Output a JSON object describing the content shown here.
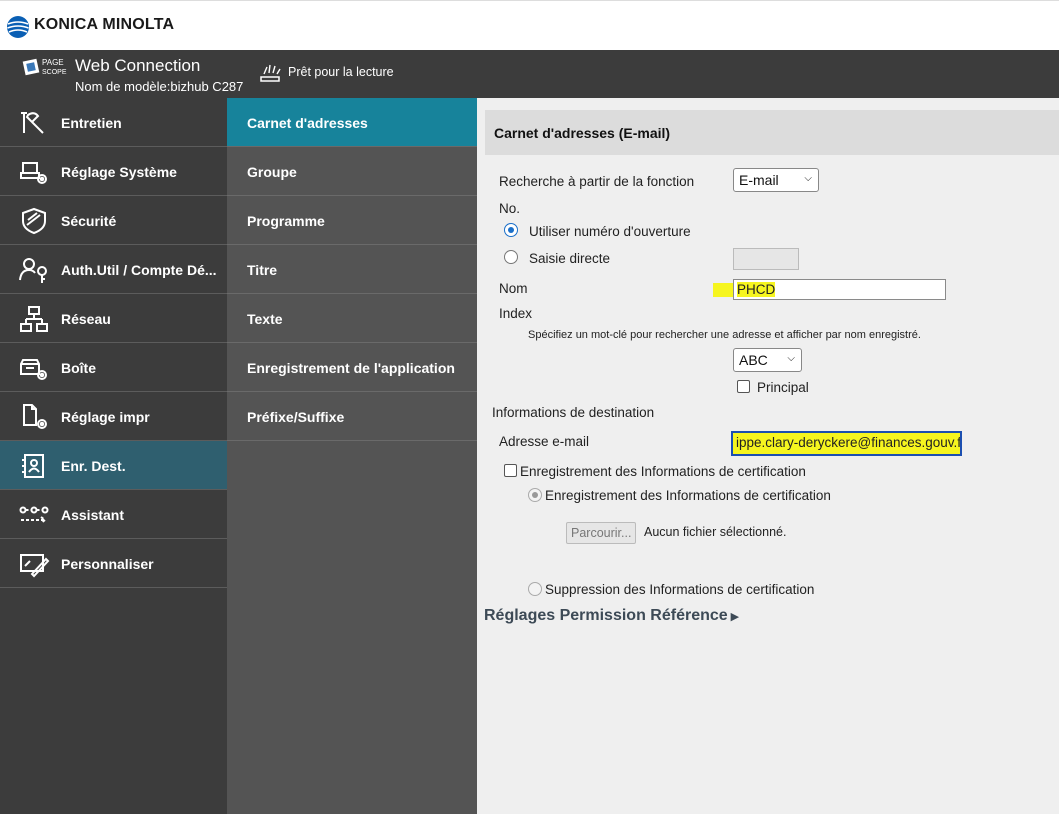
{
  "brand": {
    "name": "KONICA MINOLTA"
  },
  "header": {
    "logo_lines": [
      "PAGE",
      "SCOPE"
    ],
    "title": "Web Connection",
    "model": "Nom de modèle:bizhub C287",
    "status": "Prêt pour la lecture"
  },
  "sidebar": {
    "items": [
      {
        "label": "Entretien",
        "icon": "wrench-icon"
      },
      {
        "label": "Réglage Système",
        "icon": "system-settings-icon"
      },
      {
        "label": "Sécurité",
        "icon": "shield-icon"
      },
      {
        "label": "Auth.Util / Compte Dé...",
        "icon": "user-key-icon"
      },
      {
        "label": "Réseau",
        "icon": "network-icon"
      },
      {
        "label": "Boîte",
        "icon": "box-icon"
      },
      {
        "label": "Réglage impr",
        "icon": "printer-settings-icon"
      },
      {
        "label": "Enr. Dest.",
        "icon": "address-book-icon",
        "active": true
      },
      {
        "label": "Assistant",
        "icon": "assistant-icon"
      },
      {
        "label": "Personnaliser",
        "icon": "customize-icon"
      }
    ]
  },
  "submenu": {
    "items": [
      {
        "label": "Carnet d'adresses",
        "active": true
      },
      {
        "label": "Groupe"
      },
      {
        "label": "Programme"
      },
      {
        "label": "Titre"
      },
      {
        "label": "Texte"
      },
      {
        "label": "Enregistrement de l'application"
      },
      {
        "label": "Préfixe/Suffixe"
      }
    ]
  },
  "main": {
    "title": "Carnet d'adresses (E-mail)",
    "search_label": "Recherche à partir de la fonction",
    "search_value": "E-mail",
    "no_label": "No.",
    "radio_open_number": "Utiliser numéro d'ouverture",
    "radio_direct": "Saisie directe",
    "name_label": "Nom",
    "name_value": "PHCD",
    "index_label": "Index",
    "index_hint": "Spécifiez un mot-clé pour rechercher une adresse et afficher par nom enregistré.",
    "index_value": "ABC",
    "principal_label": "Principal",
    "dest_info_label": "Informations de destination",
    "email_label": "Adresse e-mail",
    "email_value": "ippe.clary-deryckere@finances.gouv.fr",
    "cert_checkbox_label": "Enregistrement des Informations de certification",
    "cert_radio_register": "Enregistrement des Informations de certification",
    "browse_button": "Parcourir...",
    "no_file": "Aucun fichier sélectionné.",
    "cert_radio_delete": "Suppression des Informations de certification",
    "permission_link": "Réglages Permission Référence"
  },
  "colors": {
    "header_bg": "#3c3c3c",
    "submenu_bg": "#545454",
    "submenu_active": "#17839b",
    "sidebar_active": "#2f5f6f",
    "highlight": "#f6f51f",
    "content_bg": "#efefef"
  }
}
